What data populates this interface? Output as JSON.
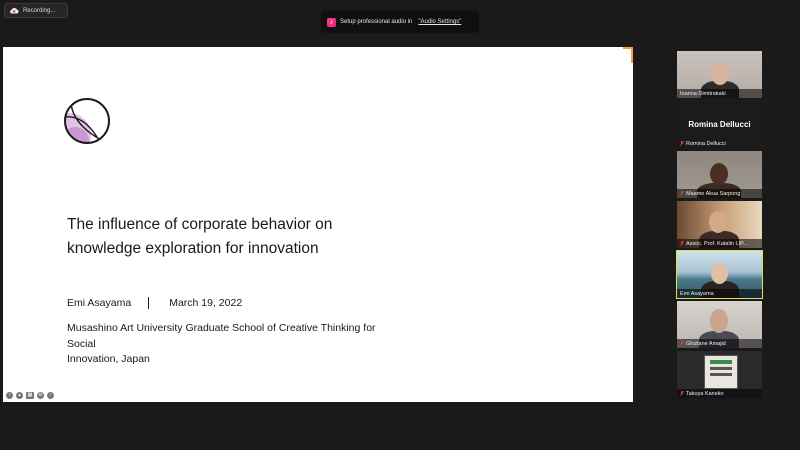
{
  "recording": {
    "label": "Recording..."
  },
  "audio_banner": {
    "text": "Setup professional audio in",
    "link": "\"Audio Settings\""
  },
  "slide": {
    "title_line1": "The influence of corporate behavior on",
    "title_line2": "knowledge exploration for innovation",
    "author": "Emi Asayama",
    "date": "March 19, 2022",
    "affiliation_line1": "Musashino Art University Graduate School of Creative Thinking for Social",
    "affiliation_line2": "Innovation, Japan"
  },
  "participants": [
    {
      "name": "Ioanna Dimitrakaki",
      "muted": false,
      "video": true
    },
    {
      "name": "Romina Dellucci",
      "big_name": "Romina Dellucci",
      "muted": true,
      "video": false
    },
    {
      "name": "Maame Akua Sarpong",
      "muted": true,
      "video": true
    },
    {
      "name": "Assoc. Prof. Katalin LIP...",
      "muted": true,
      "video": true
    },
    {
      "name": "Emi Asayama",
      "muted": false,
      "video": true,
      "active": true
    },
    {
      "name": "Ghizlane Amajid",
      "muted": true,
      "video": true
    },
    {
      "name": "Takuya Kaneko",
      "muted": true,
      "video": true
    }
  ],
  "colors": {
    "active_border": "#d9e35a",
    "muted_icon": "#e0383a",
    "logo_fill": "#d9b3de"
  }
}
